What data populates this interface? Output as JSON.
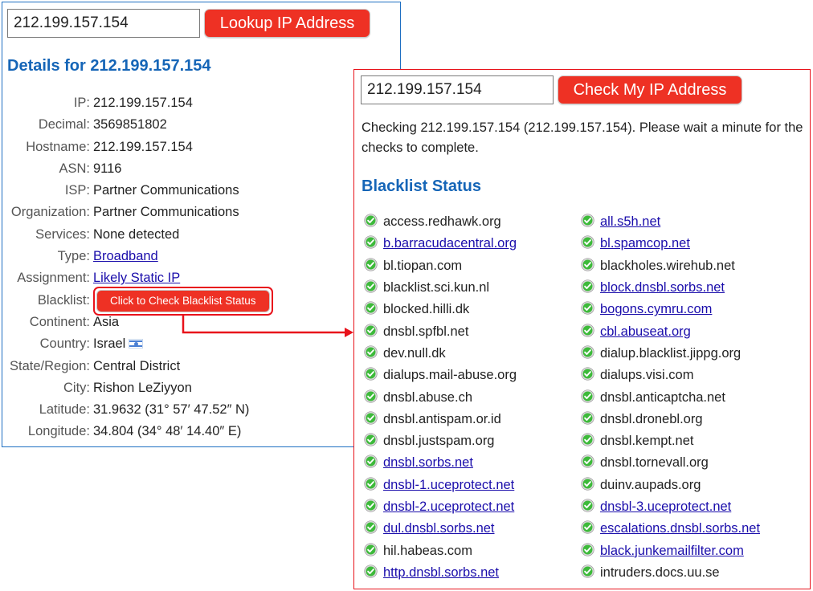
{
  "lookup_panel": {
    "ip_input_value": "212.199.157.154",
    "lookup_button_label": "Lookup IP Address",
    "heading": "Details for 212.199.157.154",
    "details": [
      {
        "label": "IP:",
        "value": "212.199.157.154"
      },
      {
        "label": "Decimal:",
        "value": "3569851802"
      },
      {
        "label": "Hostname:",
        "value": "212.199.157.154"
      },
      {
        "label": "ASN:",
        "value": "9116"
      },
      {
        "label": "ISP:",
        "value": "Partner Communications"
      },
      {
        "label": "Organization:",
        "value": "Partner Communications"
      },
      {
        "label": "Services:",
        "value": "None detected"
      },
      {
        "label": "Type:",
        "value": "Broadband",
        "link": true
      },
      {
        "label": "Assignment:",
        "value": "Likely Static IP",
        "link": true
      },
      {
        "label": "Blacklist:",
        "button_label": "Click to Check Blacklist Status"
      },
      {
        "label": "Continent:",
        "value": "Asia"
      },
      {
        "label": "Country:",
        "value": "Israel",
        "icon": "israel-flag-icon"
      },
      {
        "label": "State/Region:",
        "value": "Central District"
      },
      {
        "label": "City:",
        "value": "Rishon LeZiyyon"
      },
      {
        "label": "Latitude:",
        "value": "31.9632  (31° 57′ 47.52″ N)"
      },
      {
        "label": "Longitude:",
        "value": "34.804  (34° 48′ 14.40″ E)"
      }
    ]
  },
  "blacklist_panel": {
    "ip_input_value": "212.199.157.154",
    "check_button_label": "Check My IP Address",
    "checking_message": "Checking 212.199.157.154 (212.199.157.154). Please wait a minute for the checks to complete.",
    "heading": "Blacklist Status",
    "status_icon": "green-check-circle-icon",
    "colors": {
      "ok": "#3dba3a",
      "heading": "#1565b7",
      "button": "#ee3124",
      "highlight": "#e8121b"
    },
    "columns": [
      [
        {
          "name": "access.redhawk.org",
          "link": false
        },
        {
          "name": "b.barracudacentral.org",
          "link": true
        },
        {
          "name": "bl.tiopan.com",
          "link": false
        },
        {
          "name": "blacklist.sci.kun.nl",
          "link": false
        },
        {
          "name": "blocked.hilli.dk",
          "link": false
        },
        {
          "name": "dnsbl.spfbl.net",
          "link": false
        },
        {
          "name": "dev.null.dk",
          "link": false
        },
        {
          "name": "dialups.mail-abuse.org",
          "link": false
        },
        {
          "name": "dnsbl.abuse.ch",
          "link": false
        },
        {
          "name": "dnsbl.antispam.or.id",
          "link": false
        },
        {
          "name": "dnsbl.justspam.org",
          "link": false
        },
        {
          "name": "dnsbl.sorbs.net",
          "link": true
        },
        {
          "name": "dnsbl-1.uceprotect.net",
          "link": true
        },
        {
          "name": "dnsbl-2.uceprotect.net",
          "link": true
        },
        {
          "name": "dul.dnsbl.sorbs.net",
          "link": true
        },
        {
          "name": "hil.habeas.com",
          "link": false
        },
        {
          "name": "http.dnsbl.sorbs.net",
          "link": true
        }
      ],
      [
        {
          "name": "all.s5h.net",
          "link": true
        },
        {
          "name": "bl.spamcop.net",
          "link": true
        },
        {
          "name": "blackholes.wirehub.net",
          "link": false
        },
        {
          "name": "block.dnsbl.sorbs.net",
          "link": true
        },
        {
          "name": "bogons.cymru.com",
          "link": true
        },
        {
          "name": "cbl.abuseat.org",
          "link": true
        },
        {
          "name": "dialup.blacklist.jippg.org",
          "link": false
        },
        {
          "name": "dialups.visi.com",
          "link": false
        },
        {
          "name": "dnsbl.anticaptcha.net",
          "link": false
        },
        {
          "name": "dnsbl.dronebl.org",
          "link": false
        },
        {
          "name": "dnsbl.kempt.net",
          "link": false
        },
        {
          "name": "dnsbl.tornevall.org",
          "link": false
        },
        {
          "name": "duinv.aupads.org",
          "link": false
        },
        {
          "name": "dnsbl-3.uceprotect.net",
          "link": true
        },
        {
          "name": "escalations.dnsbl.sorbs.net",
          "link": true
        },
        {
          "name": "black.junkemailfilter.com",
          "link": true
        },
        {
          "name": "intruders.docs.uu.se",
          "link": false
        }
      ]
    ]
  }
}
